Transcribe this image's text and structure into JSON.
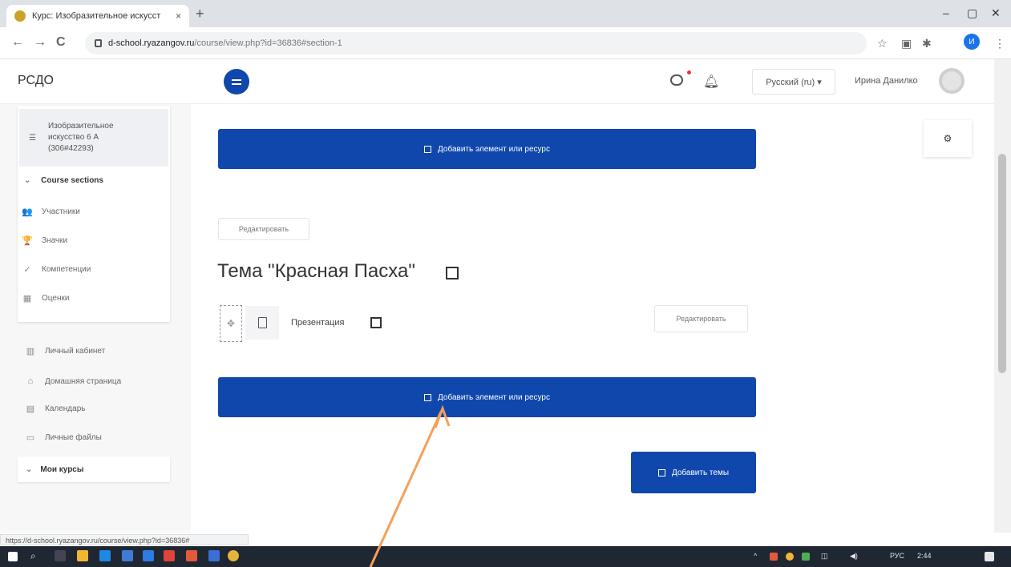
{
  "browser": {
    "tab_title": "Курс: Изобразительное искусст",
    "tab_close": "×",
    "new_tab": "+",
    "minimize": "–",
    "maximize": "▢",
    "close": "✕",
    "back": "←",
    "forward": "→",
    "reload": "C",
    "url_domain": "d-school.ryazangov.ru",
    "url_path": "/course/view.php?id=36836#section-1",
    "star": "☆",
    "profile_initial": "И",
    "menu": "⋮"
  },
  "header": {
    "brand": "РСДО",
    "language": "Русский (ru) ▾",
    "user_name": "Ирина Данилко"
  },
  "sidebar": {
    "course_name": "Изобразительное искусство 6 А (306#42293)",
    "course_sections": "Course sections",
    "course_nav": [
      {
        "icon": "users-icon",
        "glyph": "👥",
        "label": "Участники"
      },
      {
        "icon": "trophy-icon",
        "glyph": "🏆",
        "label": "Значки"
      },
      {
        "icon": "check-icon",
        "glyph": "✓",
        "label": "Компетенции"
      },
      {
        "icon": "grades-icon",
        "glyph": "▦",
        "label": "Оценки"
      }
    ],
    "site_nav": [
      {
        "icon": "dashboard-icon",
        "glyph": "▥",
        "label": "Личный кабинет"
      },
      {
        "icon": "home-icon",
        "glyph": "⌂",
        "label": "Домашняя страница"
      },
      {
        "icon": "calendar-icon",
        "glyph": "▤",
        "label": "Календарь"
      },
      {
        "icon": "folder-icon",
        "glyph": "▭",
        "label": "Личные файлы"
      }
    ],
    "my_courses": "Мои курсы"
  },
  "main": {
    "add_resource_top": "Добавить элемент или ресурс",
    "edit_label": "Редактировать",
    "topic_title": "Тема \"Красная Пасха\"",
    "resource_name": "Презентация",
    "resource_edit_label": "Редактировать",
    "add_resource_bottom": "Добавить элемент или ресурс",
    "add_topics": "Добавить темы"
  },
  "status_url": "https://d-school.ryazangov.ru/course/view.php?id=36836#",
  "taskbar": {
    "lang": "РУС",
    "time": "2:44"
  },
  "colors": {
    "accent": "#0f47ad",
    "annotation_arrow": "#f5a05a"
  }
}
